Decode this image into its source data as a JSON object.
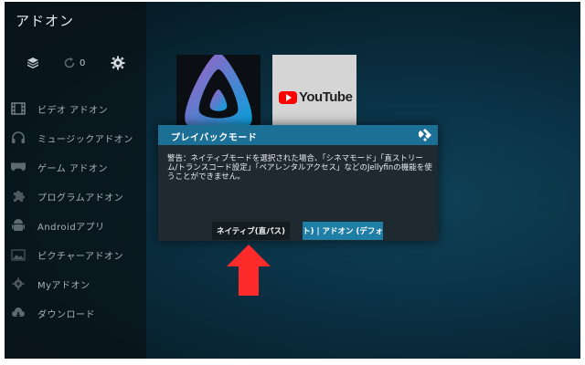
{
  "app": {
    "title": "アドオン"
  },
  "topbar": {
    "count": "0",
    "icons": [
      "box-icon",
      "refresh-icon",
      "gear-icon"
    ]
  },
  "sidebar": {
    "items": [
      {
        "label": "ビデオ アドオン",
        "icon": "film-icon"
      },
      {
        "label": "ミュージックアドオン",
        "icon": "headphones-icon"
      },
      {
        "label": "ゲーム アドオン",
        "icon": "gamepad-icon"
      },
      {
        "label": "プログラムアドオン",
        "icon": "puzzle-icon"
      },
      {
        "label": "Androidアプリ",
        "icon": "android-icon"
      },
      {
        "label": "ピクチャーアドオン",
        "icon": "picture-icon"
      },
      {
        "label": "Myアドオン",
        "icon": "gear-icon"
      },
      {
        "label": "ダウンロード",
        "icon": "cloud-download-icon"
      }
    ]
  },
  "thumbnails": {
    "jellyfin": {
      "icon": "jellyfin-logo"
    },
    "youtube": {
      "logo_text": "YouTube"
    }
  },
  "dialog": {
    "title": "プレイバックモード",
    "message": "警告：ネイティブモードを選択された場合、「シネマモード」「直ストリーム/トランスコード設定」「ペアレンタルアクセス」などのJellyfinの機能を使うことができません。",
    "buttons": {
      "native": "ネイティブ(直パス)",
      "addon": "ト) | アドオン (デフォ"
    }
  },
  "colors": {
    "dialog_header": "#1c6f95",
    "focused_button": "#1f7ea6",
    "arrow": "#ff2a2a"
  }
}
